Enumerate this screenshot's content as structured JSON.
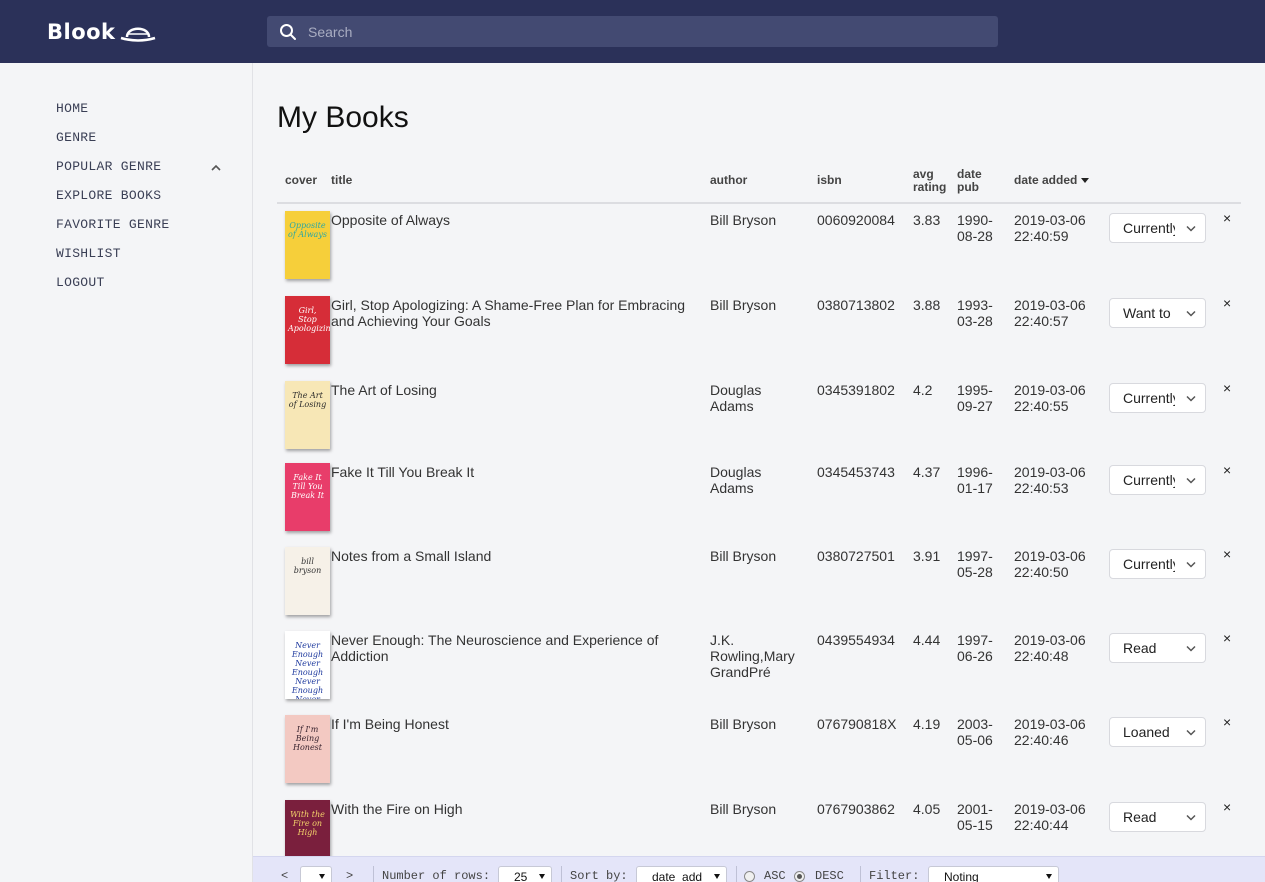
{
  "header": {
    "logo_text": "Blook",
    "search_placeholder": "Search"
  },
  "sidebar": {
    "items": [
      {
        "label": "HOME"
      },
      {
        "label": "GENRE"
      },
      {
        "label": "POPULAR GENRE"
      },
      {
        "label": "EXPLORE BOOKS"
      },
      {
        "label": "FAVORITE GENRE"
      },
      {
        "label": "WISHLIST"
      },
      {
        "label": "LOGOUT"
      }
    ]
  },
  "main": {
    "title": "My Books",
    "columns": {
      "cover": "cover",
      "title": "title",
      "author": "author",
      "isbn": "isbn",
      "avg_rating_1": "avg",
      "avg_rating_2": "rating",
      "date_pub_1": "date",
      "date_pub_2": "pub",
      "date_added": "date added"
    },
    "books": [
      {
        "title": "Opposite of Always",
        "author": "Bill Bryson",
        "isbn": "0060920084",
        "rating": "3.83",
        "pub_1": "1990-",
        "pub_2": "08-28",
        "added_1": "2019-03-06",
        "added_2": "22:40:59",
        "status": "Currently Reading",
        "cover_text": "Opposite of Always",
        "cover_bg": "#f6cf3a",
        "cover_fg": "#2aa7a4"
      },
      {
        "title": "Girl, Stop Apologizing: A Shame-Free Plan for Embracing and Achieving Your Goals",
        "author": "Bill Bryson",
        "isbn": "0380713802",
        "rating": "3.88",
        "pub_1": "1993-",
        "pub_2": "03-28",
        "added_1": "2019-03-06",
        "added_2": "22:40:57",
        "status": "Want to Read",
        "cover_text": "Girl, Stop Apologizing",
        "cover_bg": "#d62d38",
        "cover_fg": "#ffffff"
      },
      {
        "title": "The Art of Losing",
        "author": "Douglas Adams",
        "isbn": "0345391802",
        "rating": "4.2",
        "pub_1": "1995-",
        "pub_2": "09-27",
        "added_1": "2019-03-06",
        "added_2": "22:40:55",
        "status": "Currently Reading",
        "cover_text": "The Art of Losing",
        "cover_bg": "#f7e7b6",
        "cover_fg": "#2b2b2b"
      },
      {
        "title": "Fake It Till You Break It",
        "author": "Douglas Adams",
        "isbn": "0345453743",
        "rating": "4.37",
        "pub_1": "1996-",
        "pub_2": "01-17",
        "added_1": "2019-03-06",
        "added_2": "22:40:53",
        "status": "Currently Reading",
        "cover_text": "Fake It Till You Break It",
        "cover_bg": "#e83d6a",
        "cover_fg": "#ffffff"
      },
      {
        "title": "Notes from a Small Island",
        "author": "Bill Bryson",
        "isbn": "0380727501",
        "rating": "3.91",
        "pub_1": "1997-",
        "pub_2": "05-28",
        "added_1": "2019-03-06",
        "added_2": "22:40:50",
        "status": "Currently Reading",
        "cover_text": "bill bryson",
        "cover_bg": "#f6f1e8",
        "cover_fg": "#333333"
      },
      {
        "title": "Never Enough: The Neuroscience and Experience of Addiction",
        "author": "J.K. Rowling,Mary GrandPré",
        "isbn": "0439554934",
        "rating": "4.44",
        "pub_1": "1997-",
        "pub_2": "06-26",
        "added_1": "2019-03-06",
        "added_2": "22:40:48",
        "status": "Read",
        "cover_text": "Never Enough Never Enough Never Enough Never Enough",
        "cover_bg": "#ffffff",
        "cover_fg": "#1f3a9e"
      },
      {
        "title": "If I'm Being Honest",
        "author": "Bill Bryson",
        "isbn": "076790818X",
        "rating": "4.19",
        "pub_1": "2003-",
        "pub_2": "05-06",
        "added_1": "2019-03-06",
        "added_2": "22:40:46",
        "status": "Loaned",
        "cover_text": "If I'm Being Honest",
        "cover_bg": "#f3c9c2",
        "cover_fg": "#3a2530"
      },
      {
        "title": "With the Fire on High",
        "author": "Bill Bryson",
        "isbn": "0767903862",
        "rating": "4.05",
        "pub_1": "2001-",
        "pub_2": "05-15",
        "added_1": "2019-03-06",
        "added_2": "22:40:44",
        "status": "Read",
        "cover_text": "With the Fire on High",
        "cover_bg": "#7a1f3d",
        "cover_fg": "#f4d36b"
      }
    ],
    "remove_glyph": "×"
  },
  "footer": {
    "prev": "<",
    "next": ">",
    "page_value": "",
    "rows_label": "Number of rows:",
    "rows_value": "25",
    "sort_label": "Sort by:",
    "sort_value": "date_add",
    "asc_label": "ASC",
    "desc_label": "DESC",
    "order_selected": "DESC",
    "filter_label": "Filter:",
    "filter_value": "Noting"
  },
  "colors": {
    "header_bg": "#2b3159",
    "search_bg": "#434a72",
    "page_bg": "#f4f5f7",
    "footer_bg": "#e4e5f9"
  }
}
